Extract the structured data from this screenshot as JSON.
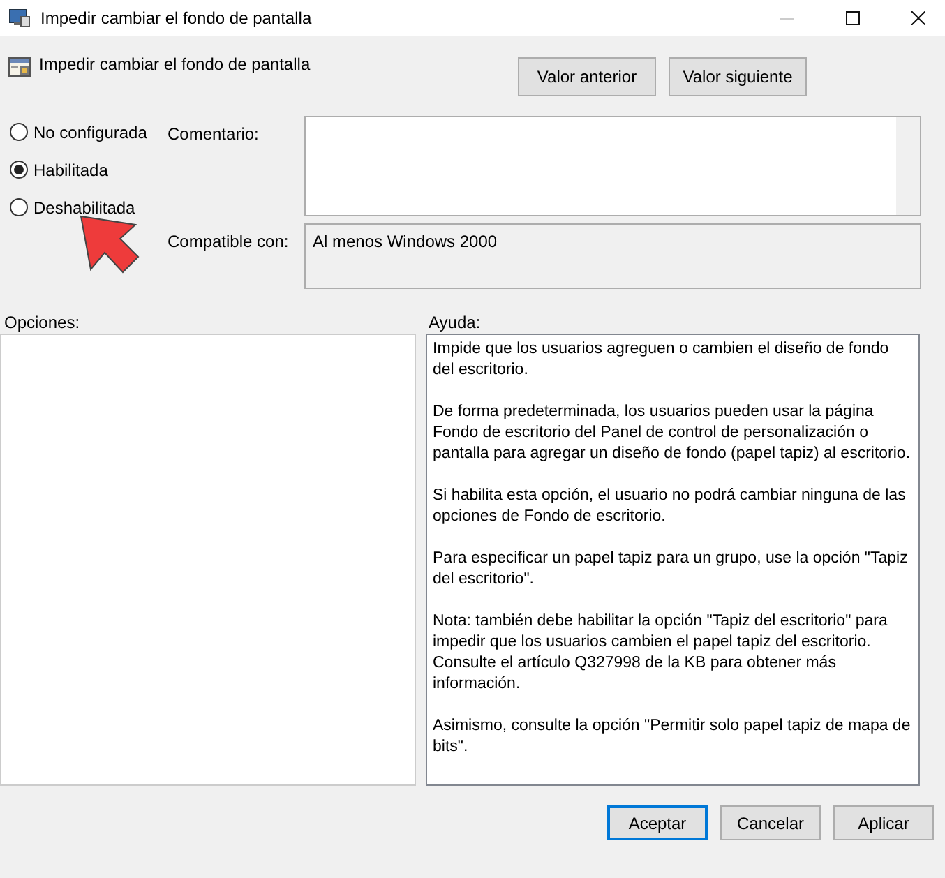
{
  "window": {
    "title": "Impedir cambiar el fondo de pantalla"
  },
  "setting": {
    "title": "Impedir cambiar el fondo de pantalla"
  },
  "nav_buttons": [
    "Valor anterior",
    "Valor siguiente"
  ],
  "states": [
    {
      "label": "No configurada",
      "selected": false
    },
    {
      "label": "Habilitada",
      "selected": true
    },
    {
      "label": "Deshabilitada",
      "selected": false
    }
  ],
  "comment": {
    "label": "Comentario:"
  },
  "compatible": {
    "label": "Compatible con:",
    "value": "Al menos Windows 2000"
  },
  "options": {
    "label": "Opciones:"
  },
  "help": {
    "label": "Ayuda:",
    "paragraphs": [
      "Impide que los usuarios agreguen o cambien el diseño de fondo del escritorio.",
      "De forma predeterminada, los usuarios pueden usar la página Fondo de escritorio del Panel de control de personalización o pantalla para agregar un diseño de fondo (papel tapiz) al escritorio.",
      "Si habilita esta opción, el usuario no podrá cambiar ninguna de las opciones de Fondo de escritorio.",
      "Para especificar un papel tapiz para un grupo, use la opción \"Tapiz del escritorio\".",
      "Nota: también debe habilitar la opción \"Tapiz del escritorio\" para impedir que los usuarios cambien el papel tapiz del escritorio. Consulte el artículo Q327998 de la KB para obtener más información.",
      "Asimismo, consulte la opción \"Permitir solo papel tapiz de mapa de bits\"."
    ]
  },
  "buttons": [
    {
      "label": "Aceptar",
      "focused": true
    },
    {
      "label": "Cancelar",
      "focused": false
    },
    {
      "label": "Aplicar",
      "focused": false
    }
  ]
}
